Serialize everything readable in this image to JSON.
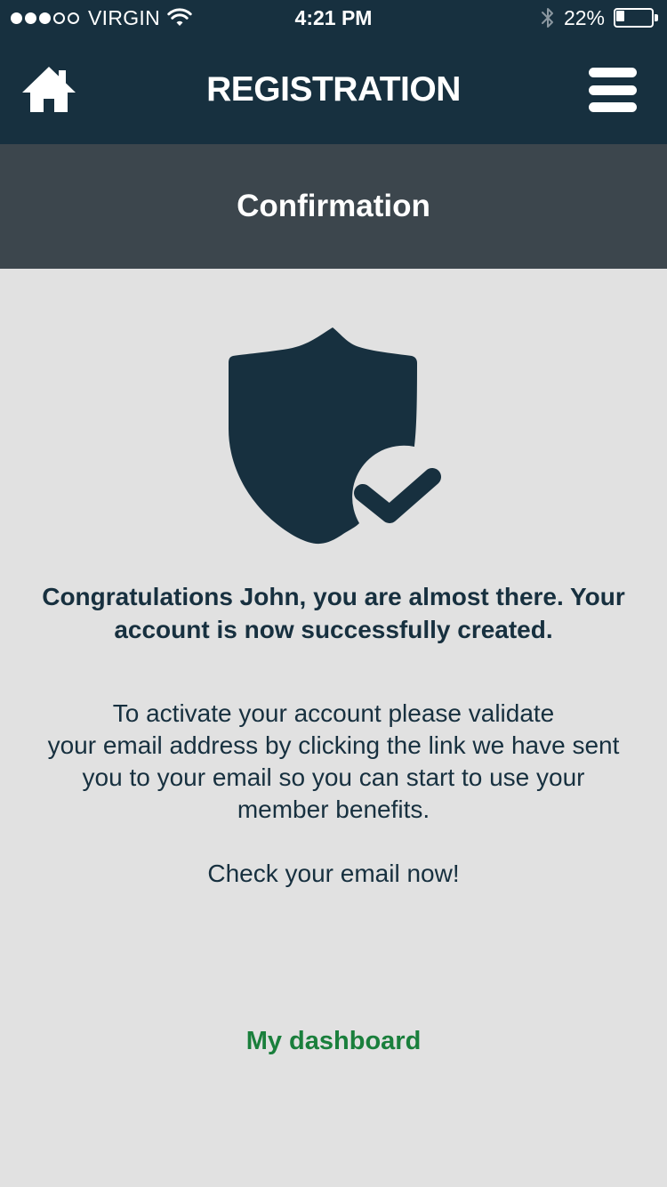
{
  "status_bar": {
    "carrier": "VIRGIN",
    "signal_dots": [
      true,
      true,
      true,
      false,
      false
    ],
    "time": "4:21 PM",
    "battery_text": "22%",
    "battery_level": 0.22,
    "icons": [
      "wifi-icon",
      "bluetooth-icon",
      "battery-icon"
    ]
  },
  "header": {
    "title": "REGISTRATION",
    "left_icon": "home-icon",
    "right_icon": "hamburger-menu-icon"
  },
  "subheader": {
    "title": "Confirmation"
  },
  "content": {
    "icon": "shield-check-icon",
    "congrats": "Congratulations John, you are almost there. Your\naccount is now successfully created.",
    "instructions": "To activate your account please validate\nyour email address by clicking the link we have sent\nyou to your email so you can start to use your\nmember benefits.",
    "check_email": "Check your email now!",
    "dashboard_link": "My dashboard"
  },
  "colors": {
    "header_bg": "#17303f",
    "subheader_bg": "#3c464d",
    "content_bg": "#e1e1e1",
    "text_dark": "#17303f",
    "link_green": "#1a7f3c"
  }
}
